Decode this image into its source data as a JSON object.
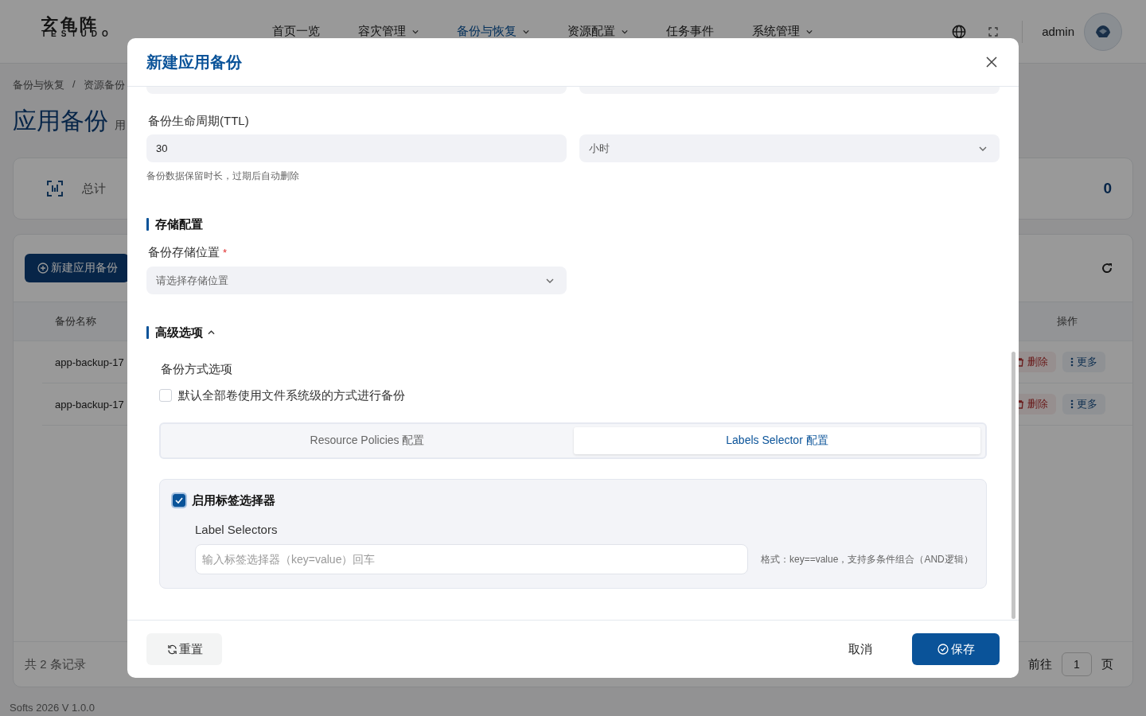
{
  "header": {
    "logo": "玄龟阵",
    "logo_sub": "TESTUDO",
    "user": "admin",
    "nav": [
      {
        "label": "首页一览",
        "has_menu": false,
        "selected": false
      },
      {
        "label": "容灾管理",
        "has_menu": true,
        "selected": false
      },
      {
        "label": "备份与恢复",
        "has_menu": true,
        "selected": true
      },
      {
        "label": "资源配置",
        "has_menu": true,
        "selected": false
      },
      {
        "label": "任务事件",
        "has_menu": false,
        "selected": false
      },
      {
        "label": "系统管理",
        "has_menu": true,
        "selected": false
      }
    ]
  },
  "breadcrumb": {
    "items": [
      "备份与恢复",
      "资源备份"
    ],
    "separator": "/"
  },
  "page": {
    "title": "应用备份",
    "subtitle": "用"
  },
  "stats": {
    "label": "总计",
    "value": "0"
  },
  "toolbar": {
    "new_button": "新建应用备份"
  },
  "table": {
    "columns": [
      "备份名称",
      "操作"
    ],
    "rows": [
      {
        "name": "app-backup-17",
        "actions": [
          {
            "kind": "delete",
            "label": "删除"
          },
          {
            "kind": "more",
            "label": "更多"
          }
        ]
      },
      {
        "name": "app-backup-17",
        "actions": [
          {
            "kind": "delete",
            "label": "删除"
          },
          {
            "kind": "more",
            "label": "更多"
          }
        ]
      }
    ]
  },
  "pagination": {
    "total": "共 2 条记录",
    "goto": "前往",
    "page": "1",
    "suffix": "页"
  },
  "footer": "Softs 2026 V 1.0.0",
  "dialog": {
    "title": "新建应用备份",
    "ttl": {
      "label": "备份生命周期(TTL)",
      "value": "30",
      "unit": "小时",
      "hint": "备份数据保留时长，过期后自动删除"
    },
    "storage": {
      "heading": "存储配置",
      "label": "备份存储位置",
      "required_mark": "*",
      "placeholder": "请选择存储位置"
    },
    "advanced": {
      "heading": "高级选项",
      "expanded": true,
      "method_label": "备份方式选项",
      "fs_backup": {
        "label": "默认全部卷使用文件系统级的方式进行备份",
        "checked": false
      },
      "tabs": [
        {
          "label": "Resource Policies 配置",
          "selected": false
        },
        {
          "label": "Labels Selector 配置",
          "selected": true
        }
      ],
      "label_selector": {
        "enabled": true,
        "label": "启用标签选择器",
        "field_label": "Label Selectors",
        "placeholder": "输入标签选择器（key=value）回车",
        "hint": "格式：key==value，支持多条件组合（AND逻辑）"
      }
    },
    "buttons": {
      "reset": "重置",
      "cancel": "取消",
      "save": "保存"
    }
  }
}
